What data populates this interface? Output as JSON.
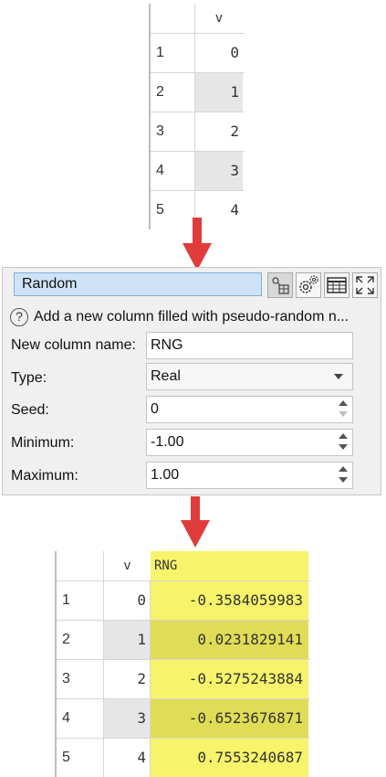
{
  "input_table": {
    "columns": [
      "v"
    ],
    "rows": [
      {
        "num": "1",
        "v": "0"
      },
      {
        "num": "2",
        "v": "1"
      },
      {
        "num": "3",
        "v": "2"
      },
      {
        "num": "4",
        "v": "3"
      },
      {
        "num": "5",
        "v": "4"
      }
    ]
  },
  "transform": {
    "name": "Random",
    "description": "Add a new column filled with pseudo-random n...",
    "help_symbol": "?",
    "fields": {
      "new_column_name": {
        "label": "New column name:",
        "value": "RNG"
      },
      "type": {
        "label": "Type:",
        "value": "Real"
      },
      "seed": {
        "label": "Seed:",
        "value": "0"
      },
      "minimum": {
        "label": "Minimum:",
        "value": "-1.00"
      },
      "maximum": {
        "label": "Maximum:",
        "value": "1.00"
      }
    },
    "toolbar_icons": [
      "connect-icon",
      "settings-icon",
      "table-view-icon",
      "maximize-icon"
    ]
  },
  "output_table": {
    "columns": [
      "v",
      "RNG"
    ],
    "highlight_color": "#f7f36a",
    "highlight_dark_color": "#e0dc55",
    "rows": [
      {
        "num": "1",
        "v": "0",
        "rng": "-0.3584059983"
      },
      {
        "num": "2",
        "v": "1",
        "rng": "0.0231829141"
      },
      {
        "num": "3",
        "v": "2",
        "rng": "-0.5275243884"
      },
      {
        "num": "4",
        "v": "3",
        "rng": "-0.6523676871"
      },
      {
        "num": "5",
        "v": "4",
        "rng": "0.7553240687"
      }
    ]
  },
  "arrow_color": "#e03c3c"
}
